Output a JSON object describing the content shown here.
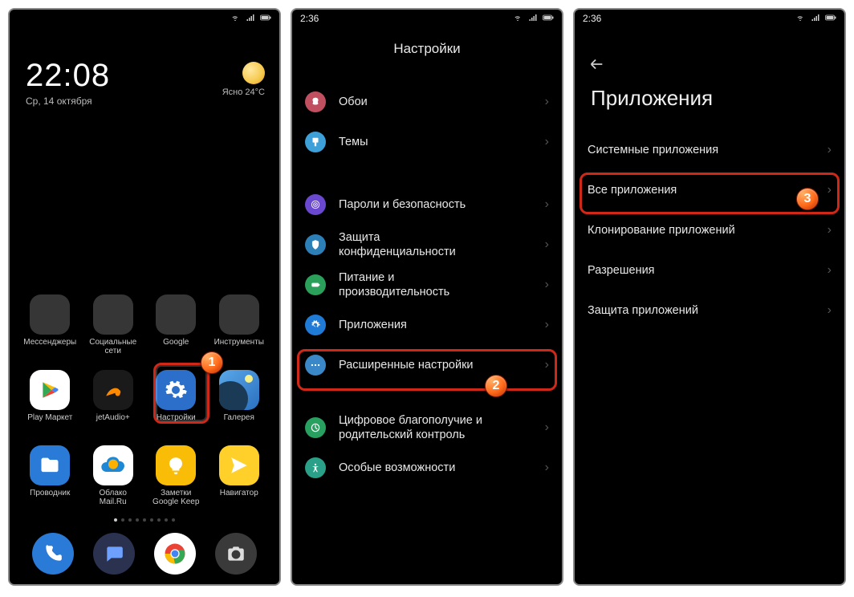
{
  "screen1": {
    "clock_time": "22:08",
    "clock_date": "Ср, 14 октября",
    "weather_desc": "Ясно  24°C",
    "folders": [
      {
        "label": "Мессенджеры"
      },
      {
        "label": "Социальные\nсети"
      },
      {
        "label": "Google"
      },
      {
        "label": "Инструменты"
      }
    ],
    "apps_row2": [
      {
        "label": "Play Маркет"
      },
      {
        "label": "jetAudio+"
      },
      {
        "label": "Настройки"
      },
      {
        "label": "Галерея"
      }
    ],
    "apps_row3": [
      {
        "label": "Проводник"
      },
      {
        "label": "Облако\nMail.Ru"
      },
      {
        "label": "Заметки\nGoogle Keep"
      },
      {
        "label": "Навигатор"
      }
    ],
    "badge": "1"
  },
  "screen2": {
    "status_time": "2:36",
    "title": "Настройки",
    "items": [
      {
        "icon": "wallpaper",
        "label": "Обои",
        "color": "#c05060"
      },
      {
        "icon": "themes",
        "label": "Темы",
        "color": "#3da0d8"
      },
      {
        "gap": true
      },
      {
        "icon": "security",
        "label": "Пароли и безопасность",
        "color": "#6a48d0"
      },
      {
        "icon": "privacy",
        "label": "Защита\nконфиденциальности",
        "color": "#2d7fb8"
      },
      {
        "icon": "battery",
        "label": "Питание и\nпроизводительность",
        "color": "#2aa05a"
      },
      {
        "icon": "apps",
        "label": "Приложения",
        "color": "#1f7bd6",
        "highlighted": true
      },
      {
        "icon": "advanced",
        "label": "Расширенные настройки",
        "color": "#3a88c8"
      },
      {
        "gap": true
      },
      {
        "icon": "wellbeing",
        "label": "Цифровое благополучие и\nродительский контроль",
        "color": "#28a060"
      },
      {
        "icon": "accessibility",
        "label": "Особые возможности",
        "color": "#2aa088"
      }
    ],
    "badge": "2"
  },
  "screen3": {
    "status_time": "2:36",
    "title": "Приложения",
    "items": [
      {
        "label": "Системные приложения"
      },
      {
        "label": "Все приложения",
        "highlighted": true
      },
      {
        "label": "Клонирование приложений"
      },
      {
        "label": "Разрешения"
      },
      {
        "label": "Защита приложений"
      }
    ],
    "badge": "3"
  }
}
